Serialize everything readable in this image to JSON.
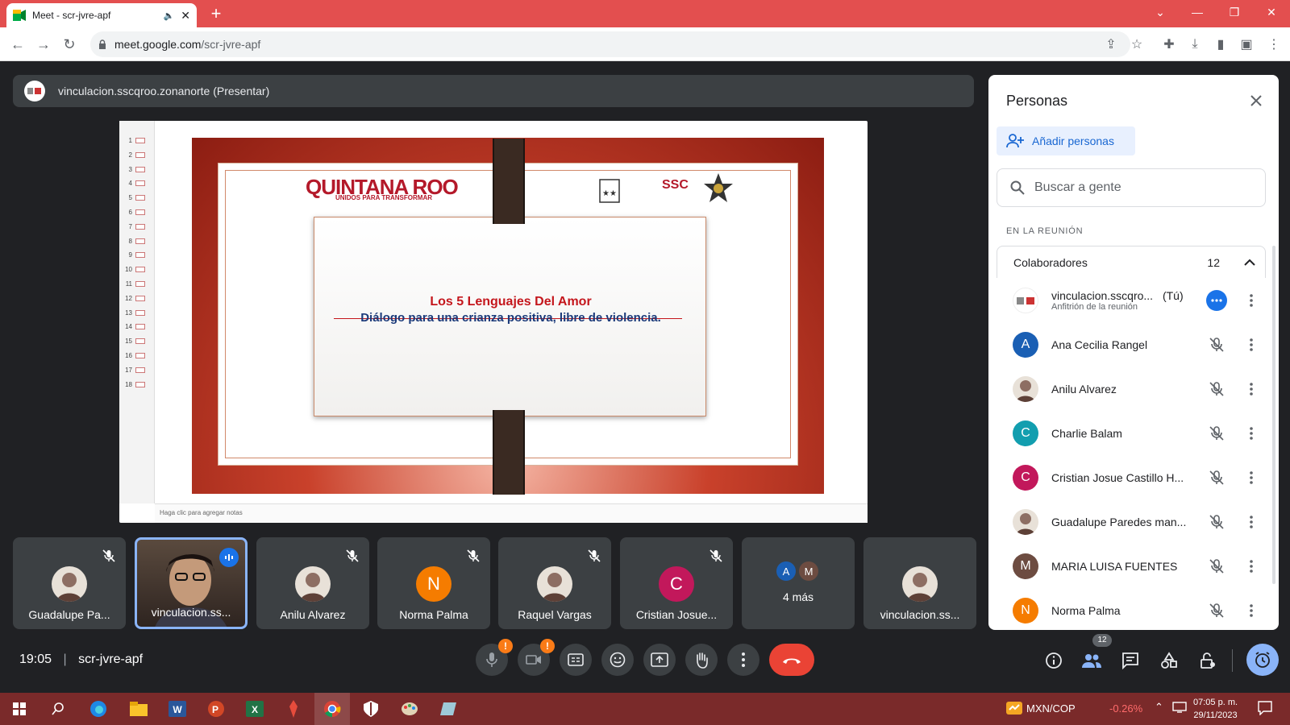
{
  "browser": {
    "tab_title": "Meet - scr-jvre-apf",
    "url_host": "meet.google.com",
    "url_path": "/scr-jvre-apf"
  },
  "presenter_bar": {
    "label": "vinculacion.sscqroo.zonanorte (Presentar)"
  },
  "slide": {
    "line1": "Los 5 Lenguajes Del Amor",
    "line2": "Diálogo para una crianza positiva, libre de violencia.",
    "logo_text": "QUINTANA ROO",
    "logo_sub": "UNIDOS PARA TRANSFORMAR",
    "ssc_text": "SSC",
    "notes_placeholder": "Haga clic para agregar notas",
    "thumb_numbers": [
      "1",
      "2",
      "3",
      "4",
      "5",
      "6",
      "7",
      "8",
      "9",
      "10",
      "11",
      "12",
      "13",
      "14",
      "15",
      "16",
      "17",
      "18"
    ]
  },
  "tiles": [
    {
      "name": "Guadalupe Pa...",
      "type": "photo"
    },
    {
      "name": "vinculacion.ss...",
      "type": "video",
      "active": true
    },
    {
      "name": "Anilu Alvarez",
      "type": "photo"
    },
    {
      "name": "Norma Palma",
      "type": "letter",
      "letter": "N",
      "color": "#f57c00"
    },
    {
      "name": "Raquel Vargas",
      "type": "photo"
    },
    {
      "name": "Cristian Josue...",
      "type": "letter",
      "letter": "C",
      "color": "#c2185b"
    },
    {
      "name": "4 más",
      "type": "more",
      "letters": [
        "A",
        "M"
      ]
    },
    {
      "name": "vinculacion.ss...",
      "type": "photo"
    }
  ],
  "panel": {
    "title": "Personas",
    "add_label": "Añadir personas",
    "search_placeholder": "Buscar a gente",
    "section_label": "EN LA REUNIÓN",
    "group_label": "Colaboradores",
    "group_count": "12",
    "people": [
      {
        "name": "vinculacion.sscqro...",
        "tag": "(Tú)",
        "sub": "Anfitrión de la reunión",
        "avatar": "logo"
      },
      {
        "name": "Ana Cecilia Rangel",
        "letter": "A",
        "color": "#1a5fb4"
      },
      {
        "name": "Anilu Alvarez",
        "avatar": "photo"
      },
      {
        "name": "Charlie Balam",
        "letter": "C",
        "color": "#129eaf"
      },
      {
        "name": "Cristian Josue Castillo H...",
        "letter": "C",
        "color": "#c2185b"
      },
      {
        "name": "Guadalupe Paredes man...",
        "avatar": "photo"
      },
      {
        "name": "MARIA LUISA FUENTES",
        "letter": "M",
        "color": "#6d4c41"
      },
      {
        "name": "Norma Palma",
        "letter": "N",
        "color": "#f57c00"
      }
    ]
  },
  "bottom": {
    "time": "19:05",
    "meeting_code": "scr-jvre-apf",
    "people_badge": "12"
  },
  "taskbar": {
    "currency": "MXN/COP",
    "change": "-0.26%",
    "clock_time": "07:05 p. m.",
    "clock_date": "29/11/2023"
  },
  "colors": {
    "tab_bar": "#e34f4f",
    "end_call": "#ea4335",
    "accent_blue": "#1a73e8",
    "taskbar": "#7a2a2a"
  }
}
